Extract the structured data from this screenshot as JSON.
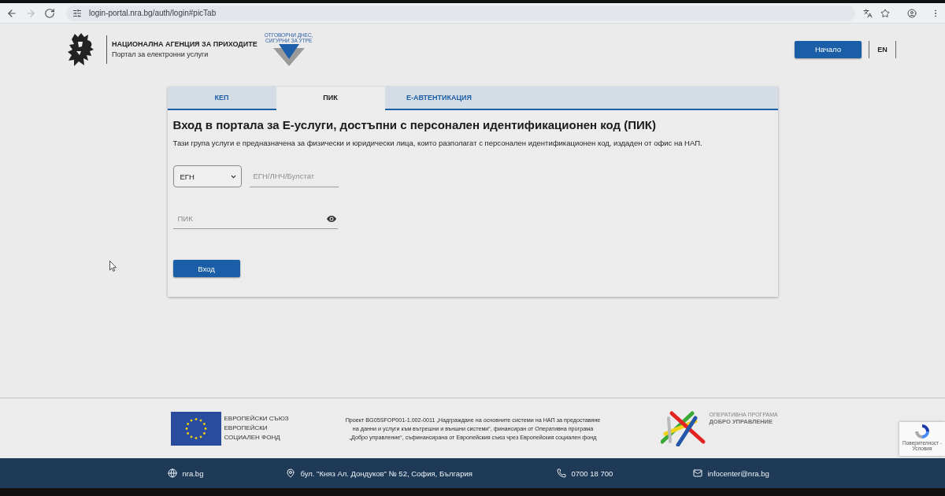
{
  "browser": {
    "url": "login-portal.nra.bg/auth/login#picTab",
    "nav_buttons": [
      {
        "kind": "back",
        "disabled": false
      },
      {
        "kind": "forward",
        "disabled": true
      },
      {
        "kind": "reload",
        "disabled": false
      }
    ]
  },
  "header": {
    "agency_name": "НАЦИОНАЛНА АГЕНЦИЯ ЗА ПРИХОДИТЕ",
    "portal_name": "Портал за електронни услуги",
    "logo_slogan": "ОТГОВОРНИ ДНЕС, СИГУРНИ ЗА УТРЕ",
    "home_button": "Начало",
    "language_button": "EN"
  },
  "login_card": {
    "tabs": [
      {
        "label": "КЕП",
        "selected": false
      },
      {
        "label": "ПИК",
        "selected": true
      },
      {
        "label": "Е-АВТЕНТИКАЦИЯ",
        "selected": false
      }
    ],
    "title": "Вход в портала за Е-услуги, достъпни с персонален идентификационен код (ПИК)",
    "description": "Тази група услуги е предназначена за физически и юридически лица, които разполагат с персонален идентификационен код, издаден от офис на НАП.",
    "id_type_select": {
      "value": "ЕГН"
    },
    "id_field": {
      "placeholder": "ЕГН/ЛНЧ/Булстат"
    },
    "pin_field": {
      "placeholder": "ПИК"
    },
    "submit_button": "Вход"
  },
  "footer": {
    "eu_label_lines": [
      "ЕВРОПЕЙСКИ СЪЮЗ",
      "ЕВРОПЕЙСКИ",
      "СОЦИАЛЕН ФОНД"
    ],
    "project_text_lines": [
      "Проект BG05SFOP001-1.002-0011 „Надграждане на основните системи на НАП за предоставяне",
      "на данни и услуги към вътрешни и външни системи“, финансиран от Оперативна програма",
      "„Добро управление“, съфинансирана от Европейския съюз чрез Европейския социален фонд"
    ],
    "programme_logo": {
      "caption": "ОПЕРАТИВНА ПРОГРАМА",
      "name": "ДОБРО УПРАВЛЕНИЕ"
    },
    "contacts": [
      {
        "kind": "website",
        "text": "nra.bg"
      },
      {
        "kind": "address",
        "text": "бул. \"Княз Ал. Дондуков\" № 52, София, България"
      },
      {
        "kind": "phone",
        "text": "0700 18 700"
      },
      {
        "kind": "email",
        "text": "infocenter@nra.bg"
      }
    ]
  },
  "recaptcha_badge": {
    "caption": "Поверителност - Условия"
  }
}
